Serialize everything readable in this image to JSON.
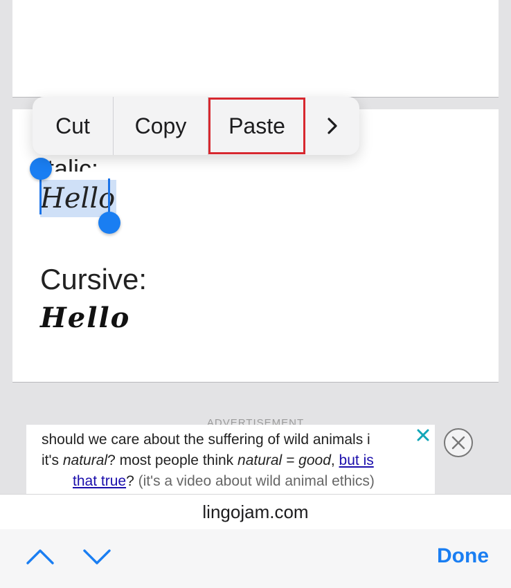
{
  "content": {
    "italic_label": "Italic:",
    "italic_sample": "Hello",
    "cursive_label": "Cursive:",
    "cursive_sample": "Hello"
  },
  "edit_menu": {
    "cut": "Cut",
    "copy": "Copy",
    "paste": "Paste",
    "more_icon": "chevron-right-icon",
    "highlight_color": "#d7282f"
  },
  "ad": {
    "label": "ADVERTISEMENT",
    "line1": "should we care about the suffering of wild animals i",
    "line2_start": "it's ",
    "line2_em1": "natural",
    "line2_mid": "? most people think ",
    "line2_em2": "natural = good",
    "line2_comma": ", ",
    "line2_link": "but is",
    "line3_link": "that true",
    "line3_q": "?",
    "line3_rest": " (it's a video about wild animal ethics)",
    "dismiss_icon": "close-x-icon",
    "close_icon": "circle-close-icon"
  },
  "address_bar": {
    "domain": "lingojam.com"
  },
  "toolbar": {
    "prev_icon": "chevron-up-icon",
    "next_icon": "chevron-down-icon",
    "done_label": "Done",
    "accent_color": "#1a7ef2"
  }
}
